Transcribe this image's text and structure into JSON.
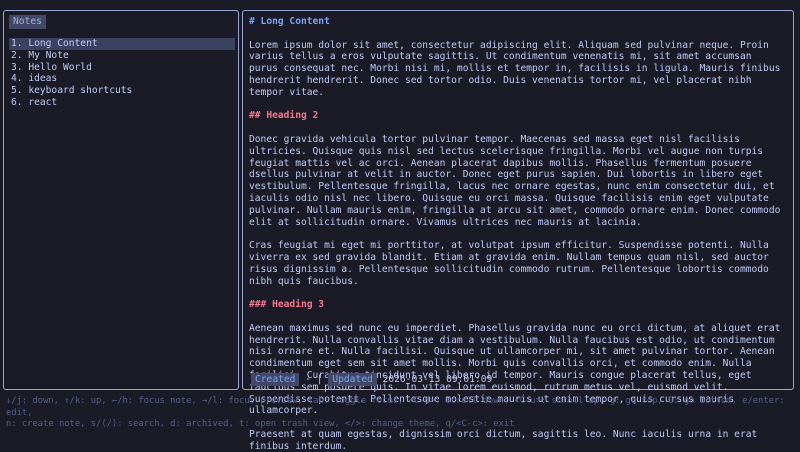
{
  "sidebar": {
    "title": "Notes",
    "items": [
      {
        "label": "1. Long Content"
      },
      {
        "label": "2. My Note"
      },
      {
        "label": "3. Hello World"
      },
      {
        "label": "4. ideas"
      },
      {
        "label": "5. keyboard shortcuts"
      },
      {
        "label": "6. react"
      }
    ]
  },
  "preview": {
    "heading1": "# Long Content",
    "para1": "Lorem ipsum dolor sit amet, consectetur adipiscing elit. Aliquam sed pulvinar neque. Proin varius tellus a eros vulputate sagittis. Ut condimentum venenatis mi, sit amet accumsan purus consequat nec. Morbi nisi mi, mollis et tempor in, facilisis in ligula. Mauris finibus hendrerit hendrerit. Donec sed tortor odio. Duis venenatis tortor mi, vel placerat nibh tempor vitae.",
    "heading2": "## Heading 2",
    "para2": "Donec gravida vehicula tortor pulvinar tempor. Maecenas sed massa eget nisl facilisis ultricies. Quisque quis nisl sed lectus scelerisque fringilla. Morbi vel augue non turpis feugiat mattis vel ac orci. Aenean placerat dapibus mollis. Phasellus fermentum posuere dsellus pulvinar at velit in auctor. Donec eget purus sapien. Dui lobortis in libero eget vestibulum. Pellentesque fringilla, lacus nec ornare egestas, nunc enim consectetur dui, et iaculis odio nisl nec libero. Quisque eu orci massa. Quisque facilisis enim eget vulputate pulvinar. Nullam mauris enim, fringilla at arcu sit amet, commodo ornare enim. Donec commodo elit at sollicitudin ornare. Vivamus ultrices nec mauris at lacinia.",
    "para3": "Cras feugiat mi eget mi porttitor, at volutpat ipsum efficitur. Suspendisse potenti. Nulla viverra ex sed gravida blandit. Etiam at gravida enim. Nullam tempus quam nisl, sed auctor risus dignissim a. Pellentesque sollicitudin commodo rutrum. Pellentesque lobortis commodo nibh quis faucibus.",
    "heading3": "### Heading 3",
    "para4": "Aenean maximus sed nunc eu imperdiet. Phasellus gravida nunc eu orci dictum, at aliquet erat hendrerit. Nulla convallis vitae diam a vestibulum. Nulla faucibus est odio, ut condimentum nisi ornare et. Nulla facilisi. Quisque ut ullamcorper mi, sit amet pulvinar tortor. Aenean condimentum eget sem sit amet mollis. Morbi quis convallis orci, et commodo enim. Nulla facilisi. Curabitur tincidunt vel libero id tempor. Mauris congue placerat tellus, eget faucibus sem posuere quis. In vitae lorem euismod, rutrum metus vel, euismod velit. Suspendisse potenti. Pellentesque molestie mauris ut enim tempor, quis cursus mauris ullamcorper.",
    "para5": "Praesent at quam egestas, dignissim orci dictum, sagittis leo. Nunc iaculis urna in erat finibus interdum."
  },
  "meta": {
    "created_label": "Created",
    "created_value": "-",
    "separator": "|",
    "updated_label": "Updated",
    "updated_value": "2026-03-13 09:01:09"
  },
  "help": {
    "line1": "↓/j: down, ↑/k: up, ←/h: focus note, →/l: focus preview, tab: toggle focus, <C-d>: scroll down, <C-u>: scroll up, g: go top, G: go bottom, e/enter: edit,",
    "line2": "n: create note, s/(/): search, d: archived, t: open trash view, </>: change theme, q/<C-c>: exit"
  },
  "colors": {
    "background": "#1a1b26",
    "border": "#9aa5ce",
    "heading1": "#7aa2f7",
    "heading": "#f7768e",
    "badge_bg": "#414868",
    "selection_bg": "#3b4261",
    "help_text": "#565f89"
  }
}
